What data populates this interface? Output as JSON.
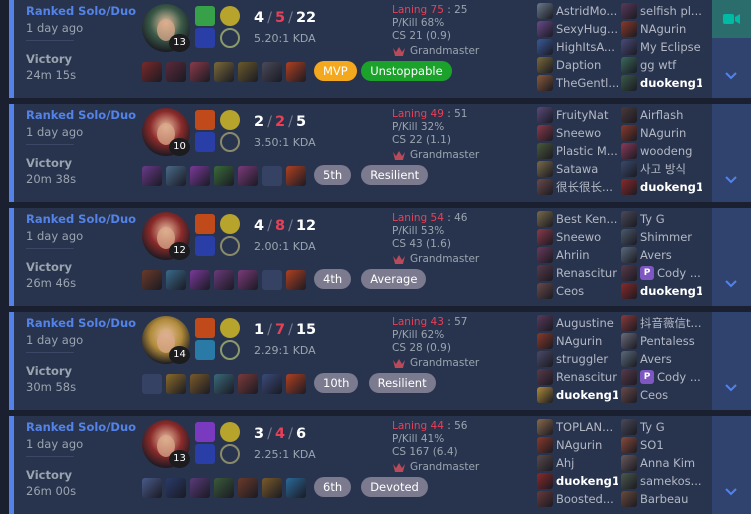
{
  "colors": {
    "accent": "#5383e8",
    "death": "#e84057",
    "mvp": "#f4a81d",
    "unstoppable": "#1ba22b",
    "tag": "#7b7a8e"
  },
  "games": [
    {
      "mode": "Ranked Solo/Duo",
      "ago": "1 day ago",
      "result": "Victory",
      "duration": "24m 15s",
      "level": "13",
      "kills": "4",
      "deaths": "5",
      "assists": "22",
      "kda_ratio": "5.20:1 KDA",
      "laning_label": "Laning 75",
      "laning_opp": " : 25",
      "pkill": "P/Kill 68%",
      "cs": "CS 21 (0.9)",
      "rank": "Grandmaster",
      "champ_color": "#3a5a48",
      "spell_colors": [
        "#36a149",
        "#2a3ea8"
      ],
      "rune_colors": [
        "#b7a42c",
        "#8a9a6a"
      ],
      "items": [
        "#7a2a2a",
        "#5a2a3a",
        "#8a3a4a",
        "#7a6a3a",
        "#6a5a2a",
        "#4a4a5a",
        "#b04020"
      ],
      "badges": [
        {
          "text": "MVP",
          "kind": "mvp"
        },
        {
          "text": "Unstoppable",
          "kind": "unst"
        }
      ],
      "video": true,
      "team1": [
        {
          "name": "AstridMo...",
          "c": "#6a7a8a"
        },
        {
          "name": "SexyHug...",
          "c": "#6a4a8a"
        },
        {
          "name": "HighItsA...",
          "c": "#3a5a9a"
        },
        {
          "name": "Daption",
          "c": "#7a6a3a"
        },
        {
          "name": "TheGentl...",
          "c": "#8a5a3a"
        }
      ],
      "team2": [
        {
          "name": "selfish pl...",
          "c": "#5a3a5a"
        },
        {
          "name": "NAgurin",
          "c": "#8a3a2a"
        },
        {
          "name": "My Eclipse",
          "c": "#4a4a7a"
        },
        {
          "name": "gg wtf",
          "c": "#3a6a5a"
        },
        {
          "name": "duokeng1",
          "c": "#3a5a48",
          "me": true
        }
      ]
    },
    {
      "mode": "Ranked Solo/Duo",
      "ago": "1 day ago",
      "result": "Victory",
      "duration": "20m 38s",
      "level": "10",
      "kills": "2",
      "deaths": "2",
      "assists": "5",
      "kda_ratio": "3.50:1 KDA",
      "laning_label": "Laning 49",
      "laning_opp": " : 51",
      "pkill": "P/Kill 32%",
      "cs": "CS 22 (1.1)",
      "rank": "Grandmaster",
      "champ_color": "#8a2a2a",
      "spell_colors": [
        "#c04a1a",
        "#2a3ea8"
      ],
      "rune_colors": [
        "#b7a42c",
        "#8a8a6a"
      ],
      "items": [
        "#6a3a8a",
        "#4a6a8a",
        "#7a3a9a",
        "#3a6a3a",
        "#7a3a7a",
        "empty",
        "#b04020"
      ],
      "badges": [
        {
          "text": "5th",
          "kind": "grey"
        },
        {
          "text": "Resilient",
          "kind": "grey"
        }
      ],
      "video": false,
      "team1": [
        {
          "name": "FruityNat",
          "c": "#5a4a7a"
        },
        {
          "name": "Sneewo",
          "c": "#8a3a4a"
        },
        {
          "name": "Plastic M...",
          "c": "#4a5a3a"
        },
        {
          "name": "Satawa",
          "c": "#7a6a4a"
        },
        {
          "name": "很长很长...",
          "c": "#6a4a4a"
        }
      ],
      "team2": [
        {
          "name": "Airflash",
          "c": "#4a3a3a"
        },
        {
          "name": "NAgurin",
          "c": "#8a3a2a"
        },
        {
          "name": "woodeng",
          "c": "#8a3a5a"
        },
        {
          "name": "사고 방식",
          "c": "#3a4a6a"
        },
        {
          "name": "duokeng1",
          "c": "#8a2a2a",
          "me": true
        }
      ]
    },
    {
      "mode": "Ranked Solo/Duo",
      "ago": "1 day ago",
      "result": "Victory",
      "duration": "26m 46s",
      "level": "12",
      "kills": "4",
      "deaths": "8",
      "assists": "12",
      "kda_ratio": "2.00:1 KDA",
      "laning_label": "Laning 54",
      "laning_opp": " : 46",
      "pkill": "P/Kill 53%",
      "cs": "CS 43 (1.6)",
      "rank": "Grandmaster",
      "champ_color": "#8a2a2a",
      "spell_colors": [
        "#c04a1a",
        "#2a3ea8"
      ],
      "rune_colors": [
        "#b7a42c",
        "#8a8a6a"
      ],
      "items": [
        "#6a3a2a",
        "#3a6a8a",
        "#7a3a9a",
        "#6a3a7a",
        "#7a3a7a",
        "empty",
        "#b04020"
      ],
      "badges": [
        {
          "text": "4th",
          "kind": "grey"
        },
        {
          "text": "Average",
          "kind": "grey"
        }
      ],
      "video": false,
      "team1": [
        {
          "name": "Best Ken...",
          "c": "#7a6a4a"
        },
        {
          "name": "Sneewo",
          "c": "#8a3a4a"
        },
        {
          "name": "Ahriin",
          "c": "#6a3a5a"
        },
        {
          "name": "Renascitur",
          "c": "#5a3a4a"
        },
        {
          "name": "Ceos",
          "c": "#6a4a4a"
        }
      ],
      "team2": [
        {
          "name": "Ty G",
          "c": "#4a4a5a"
        },
        {
          "name": "Shimmer",
          "c": "#4a5a6a"
        },
        {
          "name": "Avers",
          "c": "#5a6a7a"
        },
        {
          "name": "Cody ...",
          "c": "#5a3a4a",
          "tag": "P"
        },
        {
          "name": "duokeng1",
          "c": "#8a2a2a",
          "me": true
        }
      ]
    },
    {
      "mode": "Ranked Solo/Duo",
      "ago": "1 day ago",
      "result": "Victory",
      "duration": "30m 58s",
      "level": "14",
      "kills": "1",
      "deaths": "7",
      "assists": "15",
      "kda_ratio": "2.29:1 KDA",
      "laning_label": "Laning 43",
      "laning_opp": " : 57",
      "pkill": "P/Kill 62%",
      "cs": "CS 28 (0.9)",
      "rank": "Grandmaster",
      "champ_color": "#b08a3a",
      "spell_colors": [
        "#c04a1a",
        "#2a7aa8"
      ],
      "rune_colors": [
        "#b7a42c",
        "#8a9a6a"
      ],
      "items": [
        "empty",
        "#8a6a2a",
        "#7a5a2a",
        "#3a6a7a",
        "#7a3a3a",
        "#3a4a7a",
        "#b04020"
      ],
      "badges": [
        {
          "text": "10th",
          "kind": "grey"
        },
        {
          "text": "Resilient",
          "kind": "grey"
        }
      ],
      "video": false,
      "team1": [
        {
          "name": "Augustine",
          "c": "#5a3a5a"
        },
        {
          "name": "NAgurin",
          "c": "#8a3a2a"
        },
        {
          "name": "struggler",
          "c": "#4a4a6a"
        },
        {
          "name": "Renascitur",
          "c": "#5a3a4a"
        },
        {
          "name": "duokeng1",
          "c": "#b08a3a",
          "me": true
        }
      ],
      "team2": [
        {
          "name": "抖音薇信t...",
          "c": "#8a3a3a"
        },
        {
          "name": "Pentaless",
          "c": "#6a6a7a"
        },
        {
          "name": "Avers",
          "c": "#5a6a7a"
        },
        {
          "name": "Cody ...",
          "c": "#5a3a4a",
          "tag": "P"
        },
        {
          "name": "Ceos",
          "c": "#6a4a4a"
        }
      ]
    },
    {
      "mode": "Ranked Solo/Duo",
      "ago": "1 day ago",
      "result": "Victory",
      "duration": "26m 00s",
      "level": "13",
      "kills": "3",
      "deaths": "4",
      "assists": "6",
      "kda_ratio": "2.25:1 KDA",
      "laning_label": "Laning 44",
      "laning_opp": " : 56",
      "pkill": "P/Kill 41%",
      "cs": "CS 167 (6.4)",
      "rank": "Grandmaster",
      "champ_color": "#8a2a2a",
      "spell_colors": [
        "#7a3ac0",
        "#2a3ea8"
      ],
      "rune_colors": [
        "#b7a42c",
        "#8a8a6a"
      ],
      "items": [
        "#4a5a8a",
        "#2a3a6a",
        "#5a3a7a",
        "#3a5a3a",
        "#6a3a2a",
        "#7a5a2a",
        "#2a6a9a"
      ],
      "badges": [
        {
          "text": "6th",
          "kind": "grey"
        },
        {
          "text": "Devoted",
          "kind": "grey"
        }
      ],
      "video": false,
      "team1": [
        {
          "name": "TOPLAN...",
          "c": "#8a6a4a"
        },
        {
          "name": "NAgurin",
          "c": "#8a3a2a"
        },
        {
          "name": "Ahj",
          "c": "#5a4a4a"
        },
        {
          "name": "duokeng1",
          "c": "#8a2a2a",
          "me": true
        },
        {
          "name": "Boosted...",
          "c": "#6a3a3a"
        }
      ],
      "team2": [
        {
          "name": "Ty G",
          "c": "#4a4a5a"
        },
        {
          "name": "SO1",
          "c": "#8a4a3a"
        },
        {
          "name": "Anna Kim",
          "c": "#6a5a5a"
        },
        {
          "name": "samekos...",
          "c": "#4a5a4a"
        },
        {
          "name": "Barbeau",
          "c": "#6a4a3a"
        }
      ]
    }
  ]
}
